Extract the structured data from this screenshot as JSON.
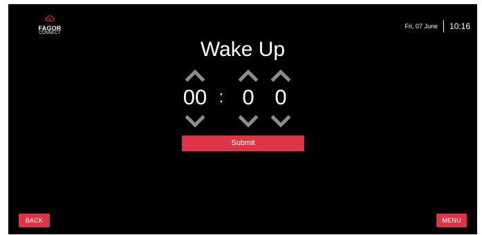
{
  "header": {
    "brand": "FAGOR",
    "subbrand": "CONNECT",
    "date": "Fri, 07 June",
    "time": "10:16"
  },
  "main": {
    "title": "Wake Up",
    "time_value": {
      "hours": "00",
      "separator": ":",
      "minutes_tens": "0",
      "minutes_ones": "0"
    },
    "submit_label": "Submit"
  },
  "footer": {
    "back_label": "BACK",
    "menu_label": "MENU"
  },
  "icons": {
    "logo": "cloud-wifi-icon",
    "increase": "chevron-up-icon",
    "decrease": "chevron-down-icon"
  },
  "colors": {
    "background": "#000000",
    "accent": "#dd3447",
    "arrow": "#8e8e8e",
    "text": "#ffffff"
  }
}
